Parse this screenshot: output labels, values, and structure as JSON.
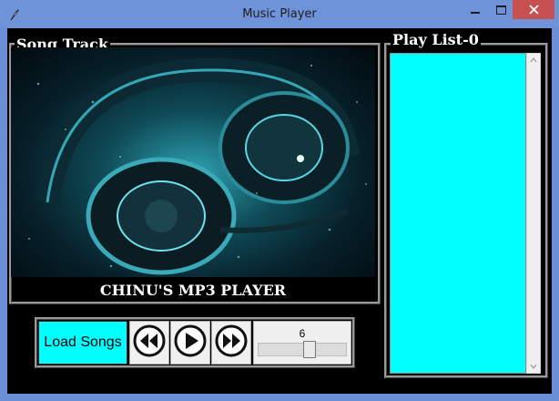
{
  "window": {
    "title": "Music Player",
    "icon": "feather-icon"
  },
  "song_track": {
    "label": "Song Track",
    "art": "headphones-image",
    "player_title": "CHINU'S MP3 PLAYER"
  },
  "playlist": {
    "label": "Play List-0",
    "items": [],
    "background": "#00ffff"
  },
  "controls": {
    "load_label": "Load Songs",
    "prev_icon": "rewind-icon",
    "play_icon": "play-icon",
    "next_icon": "fast-forward-icon",
    "volume": {
      "value": "6",
      "level": 0.6
    }
  },
  "colors": {
    "accent": "#00ffff",
    "close": "#c75050",
    "titlebar": "#6f93d9"
  }
}
